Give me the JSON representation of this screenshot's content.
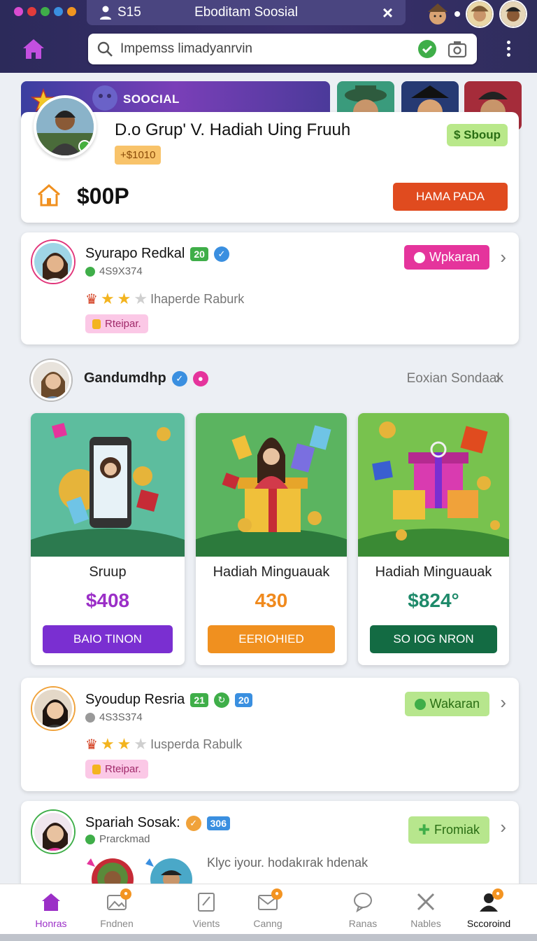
{
  "window": {
    "tab_count": "S15",
    "tab_title": "Eboditam Soosial",
    "dot_colors": [
      "#d94bd0",
      "#e23b3b",
      "#3fae49",
      "#3a8fe0",
      "#f09420"
    ]
  },
  "address_bar": {
    "placeholder": "Impemss limadyanrvin"
  },
  "hero": {
    "strip_label": "SOOCIAL",
    "title": "D.o Grup' V. Hadiah Uing Fruuh",
    "chip": "+$1010",
    "tag": "$ Sboup",
    "amount": "$00P",
    "button": "HAMA PADA"
  },
  "profiles": [
    {
      "name": "Syurapo Redkal",
      "badge": "20",
      "id": "4S9X374",
      "rating_text": "Ihaperde Raburk",
      "pill": "Rteipar.",
      "action": "Wpkaran",
      "action_color": "#e5349c"
    },
    {
      "name": "Syoudup Resria",
      "badge": "21",
      "badge2": "20",
      "id": "4S3S374",
      "rating_text": "Iusperda Rabulk",
      "pill": "Rteipar.",
      "action": "Wakaran",
      "action_color": "#b7e68d"
    },
    {
      "name": "Spariah Sosak:",
      "badge": "306",
      "id": "Prarckmad",
      "rating_text": "Klyc iyour. hodakırak hdenak",
      "action": "Fromiak",
      "action_color": "#b7e68d"
    }
  ],
  "group": {
    "name": "Gandumdhp",
    "link": "Eoxian Sondaak"
  },
  "rewards": [
    {
      "name": "Sruup",
      "price": "$408",
      "price_color": "#9b2fc7",
      "button": "BAIO TINON",
      "button_color": "#7a2fd1"
    },
    {
      "name": "Hadiah Minguauak",
      "price": "430",
      "price_color": "#f08a1e",
      "button": "EERIOHIED",
      "button_color": "#f0901f"
    },
    {
      "name": "Hadiah Minguauak",
      "price": "$824°",
      "price_color": "#1e8a6a",
      "button": "SO IOG NRON",
      "button_color": "#136b43"
    }
  ],
  "nav": [
    {
      "label": "Honras",
      "icon": "home-icon",
      "active": true
    },
    {
      "label": "Fndnen",
      "icon": "photos-icon",
      "badge": "9"
    },
    {
      "label": "Vients",
      "icon": "note-icon"
    },
    {
      "label": "Canng",
      "icon": "mail-icon",
      "badge": "9"
    },
    {
      "label": "Ranas",
      "icon": "chat-icon"
    },
    {
      "label": "Nables",
      "icon": "tools-icon"
    },
    {
      "label": "Sccoroind",
      "icon": "profile-icon",
      "badge": "9"
    }
  ]
}
